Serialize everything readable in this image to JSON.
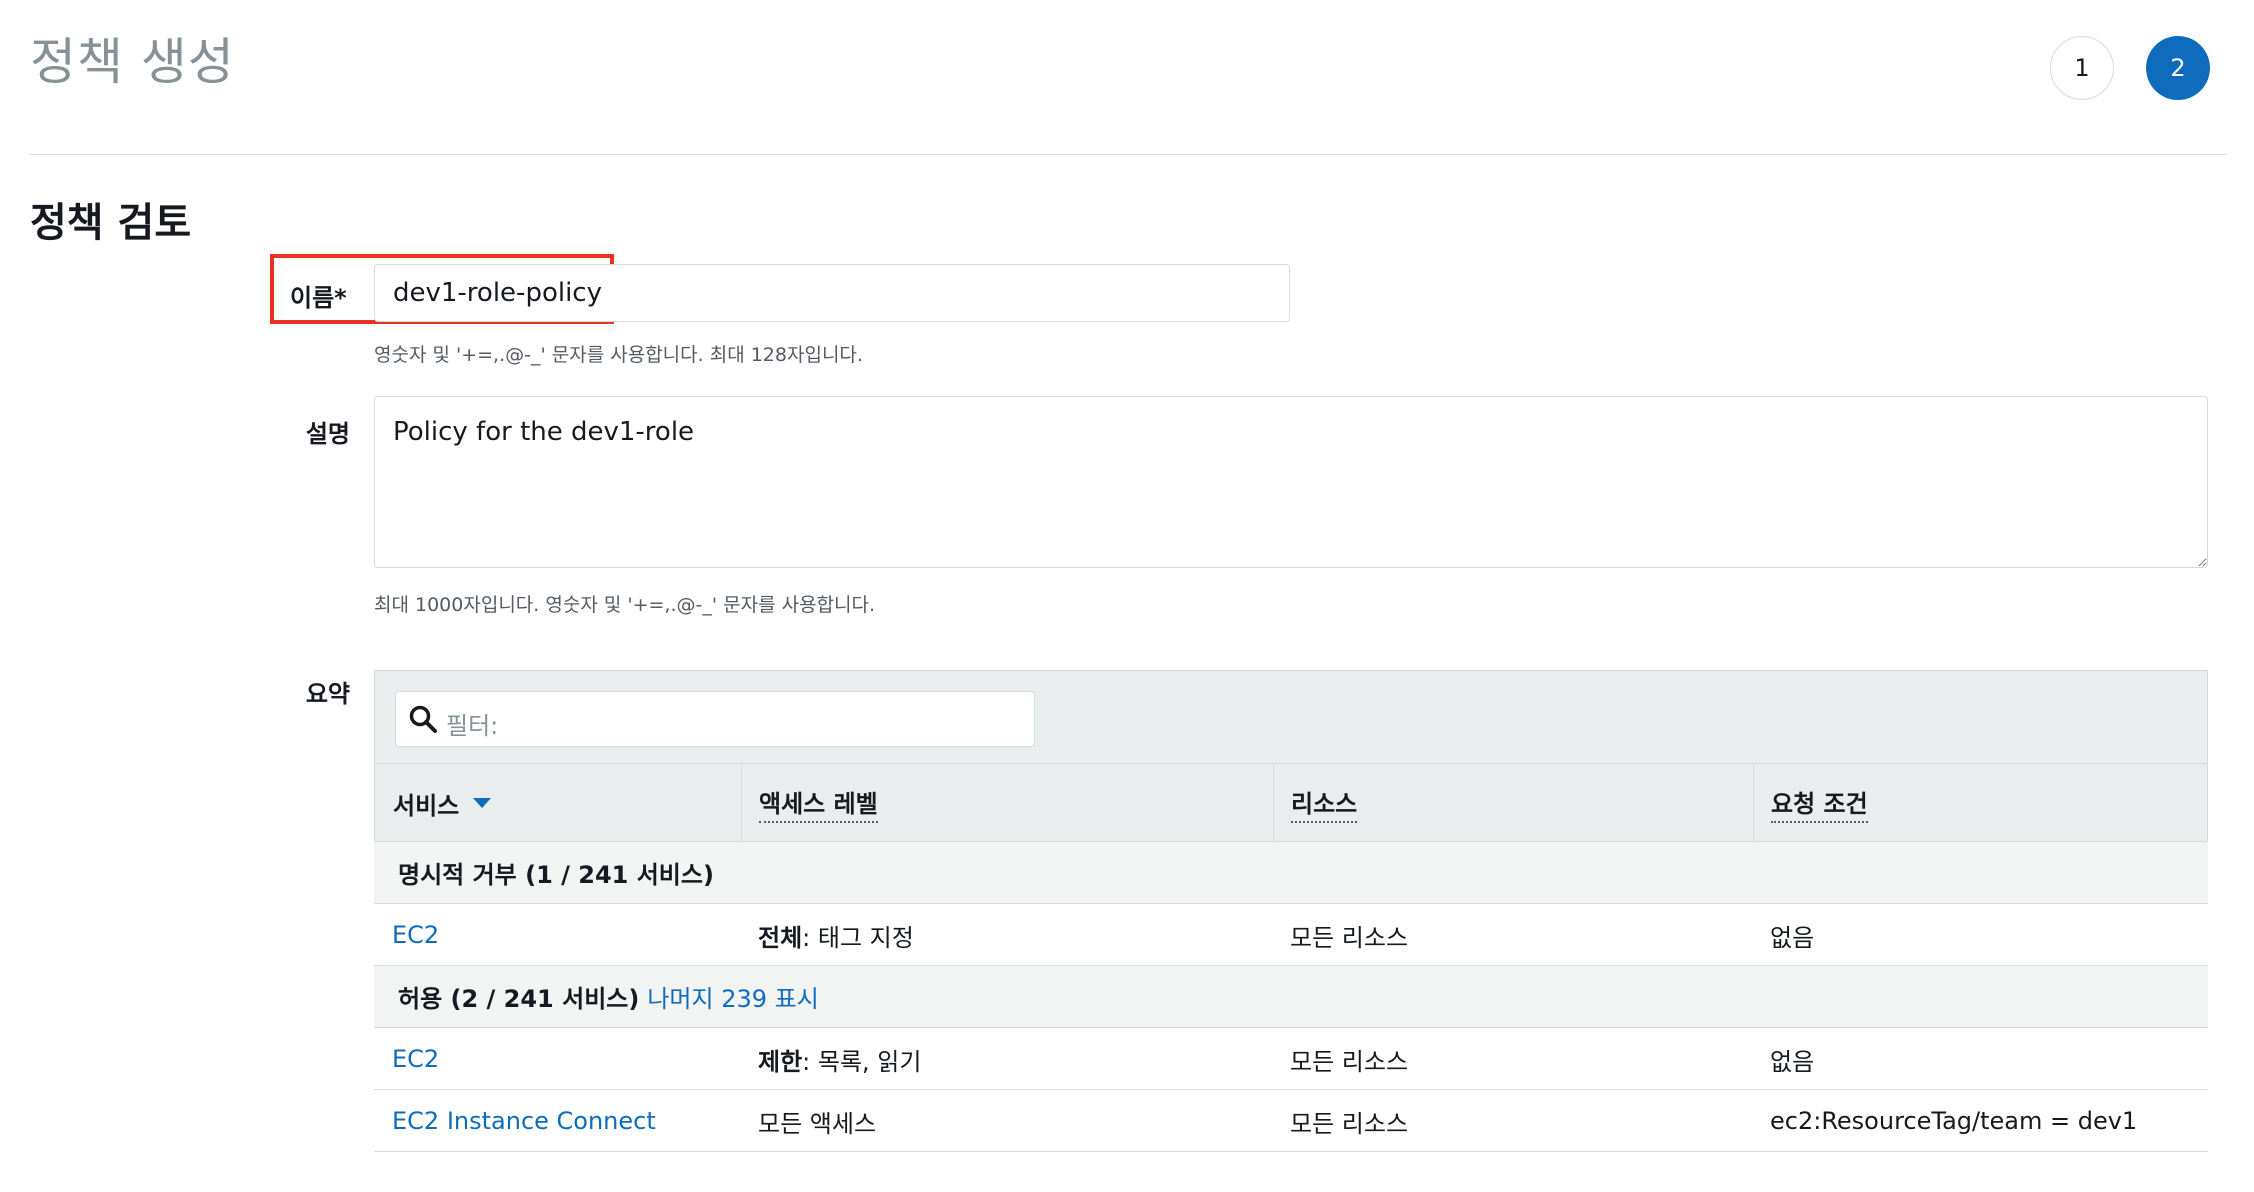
{
  "header": {
    "title": "정책 생성",
    "steps": [
      "1",
      "2"
    ]
  },
  "review": {
    "section_title": "정책 검토",
    "name_label": "이름*",
    "name_value": "dev1-role-policy",
    "name_hint": "영숫자 및 '+=,.@-_' 문자를 사용합니다. 최대 128자입니다.",
    "description_label": "설명",
    "description_value": "Policy for the dev1-role",
    "description_hint": "최대 1000자입니다. 영숫자 및 '+=,.@-_' 문자를 사용합니다.",
    "summary_label": "요약"
  },
  "summary_table": {
    "filter_placeholder": "필터:",
    "columns": [
      "서비스",
      "액세스 레벨",
      "리소스",
      "요청 조건"
    ],
    "groups": [
      {
        "label": "명시적 거부 (1 / 241 서비스)",
        "link": "",
        "rows": [
          {
            "service": "EC2",
            "access_bold": "전체",
            "access_rest": ": 태그 지정",
            "resource": "모든 리소스",
            "condition": "없음"
          }
        ]
      },
      {
        "label": "허용 (2 / 241 서비스)",
        "link": "나머지 239 표시",
        "rows": [
          {
            "service": "EC2",
            "access_bold": "제한",
            "access_rest": ": 목록, 읽기",
            "resource": "모든 리소스",
            "condition": "없음"
          },
          {
            "service": "EC2 Instance Connect",
            "access_bold": "",
            "access_rest": "모든 액세스",
            "resource": "모든 리소스",
            "condition": "ec2:ResourceTag/team = dev1"
          }
        ]
      }
    ]
  },
  "colors": {
    "link": "#0f6cbd",
    "highlight": "#e8321f",
    "step_active": "#0f6cbd"
  }
}
